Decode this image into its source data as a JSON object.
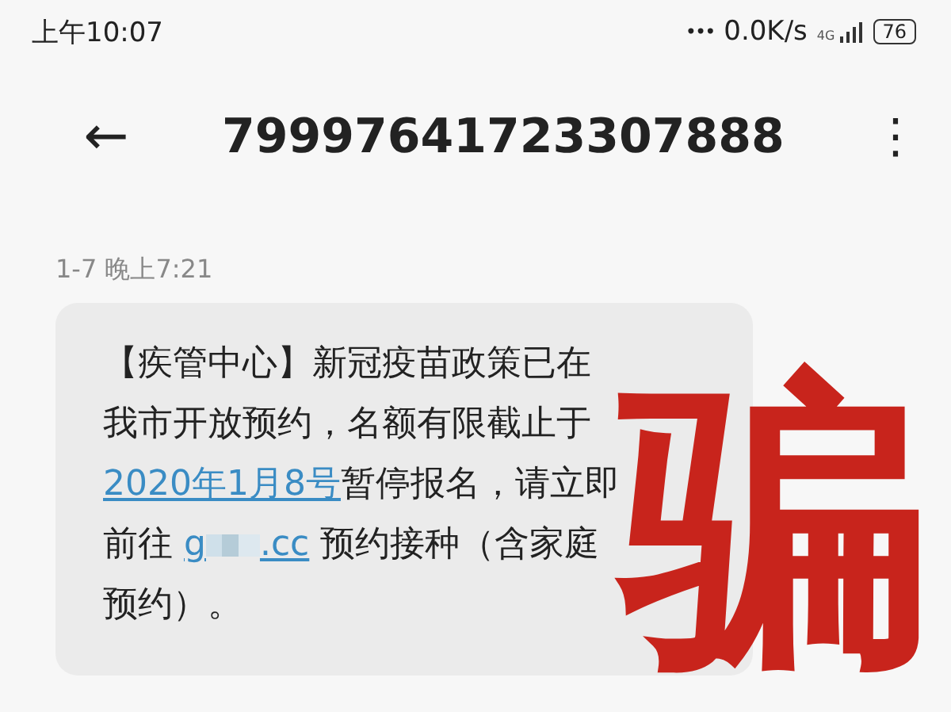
{
  "status_bar": {
    "time": "上午10:07",
    "dots": "•••",
    "speed": "0.0K/s",
    "network": "4G",
    "battery": "76"
  },
  "header": {
    "back": "←",
    "title": "79997641723307888",
    "menu": "⋮"
  },
  "messages": [
    {
      "timestamp": "1-7 晚上7:21",
      "lines": [
        [
          {
            "kind": "text",
            "text": "【疾管中心】新冠疫苗政策已在"
          }
        ],
        [
          {
            "kind": "text",
            "text": "我市开放预约，名额有限截止于"
          }
        ],
        [
          {
            "kind": "link",
            "text": "2020年1月8号"
          },
          {
            "kind": "text",
            "text": "暂停报名，请立即"
          }
        ],
        [
          {
            "kind": "text",
            "text": "前往 "
          },
          {
            "kind": "blurred_link",
            "before": "g",
            "after": ".cc"
          },
          {
            "kind": "text",
            "text": " 预约接种（含家庭"
          }
        ],
        [
          {
            "kind": "text",
            "text": "预约）。"
          }
        ]
      ]
    }
  ],
  "overlay_stamp": "骗"
}
